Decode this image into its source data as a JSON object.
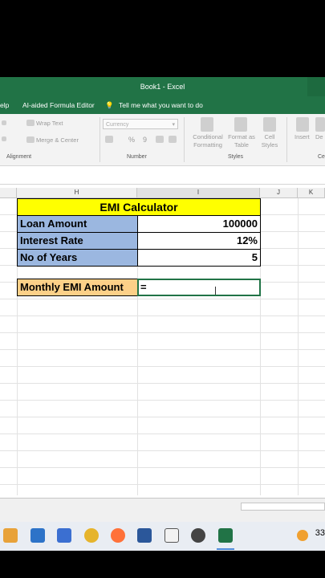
{
  "window": {
    "title": "Book1  -  Excel"
  },
  "menu": {
    "help": "elp",
    "ai_editor": "AI-aided Formula Editor",
    "tell_me": "Tell me what you want to do"
  },
  "ribbon": {
    "wrap_text": "Wrap Text",
    "merge_center": "Merge & Center",
    "number_format": "Currency",
    "percent": "%",
    "comma": "9",
    "conditional": "Conditional",
    "formatting": "Formatting",
    "format_as": "Format as",
    "table": "Table",
    "cell": "Cell",
    "styles_btn": "Styles",
    "insert": "Insert",
    "delete": "De",
    "groups": {
      "alignment": "Alignment",
      "number": "Number",
      "styles": "Styles",
      "cells": "Ce"
    }
  },
  "columns": [
    "H",
    "I",
    "J",
    "K"
  ],
  "sheet": {
    "title": "EMI Calculator",
    "rows": [
      {
        "label": "Loan Amount",
        "value": "100000"
      },
      {
        "label": "Interest Rate",
        "value": "12%"
      },
      {
        "label": "No of Years",
        "value": "5"
      }
    ],
    "emi_label": "Monthly EMI Amount",
    "emi_entry": "="
  },
  "tray": {
    "text": "33"
  },
  "colors": {
    "accent": "#217346",
    "header": "#ffff00",
    "label": "#9bb7e0",
    "emi": "#fcd088"
  }
}
